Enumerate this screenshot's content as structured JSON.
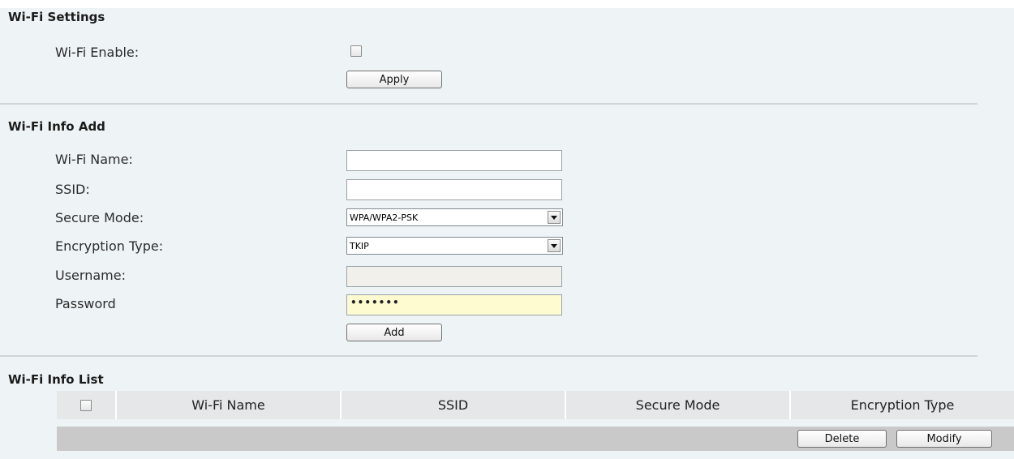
{
  "wifi_settings": {
    "title": "Wi-Fi Settings",
    "enable_label": "Wi-Fi Enable:",
    "enable_checked": false,
    "apply_label": "Apply"
  },
  "wifi_info_add": {
    "title": "Wi-Fi Info Add",
    "name_label": "Wi-Fi Name:",
    "name_value": "",
    "ssid_label": "SSID:",
    "ssid_value": "",
    "secure_mode_label": "Secure Mode:",
    "secure_mode_value": "WPA/WPA2-PSK",
    "encryption_label": "Encryption Type:",
    "encryption_value": "TKIP",
    "username_label": "Username:",
    "username_value": "",
    "password_label": "Password",
    "password_value": "•••••••",
    "add_label": "Add"
  },
  "wifi_info_list": {
    "title": "Wi-Fi Info List",
    "columns": [
      "Wi-Fi Name",
      "SSID",
      "Secure Mode",
      "Encryption Type"
    ],
    "delete_label": "Delete",
    "modify_label": "Modify"
  }
}
